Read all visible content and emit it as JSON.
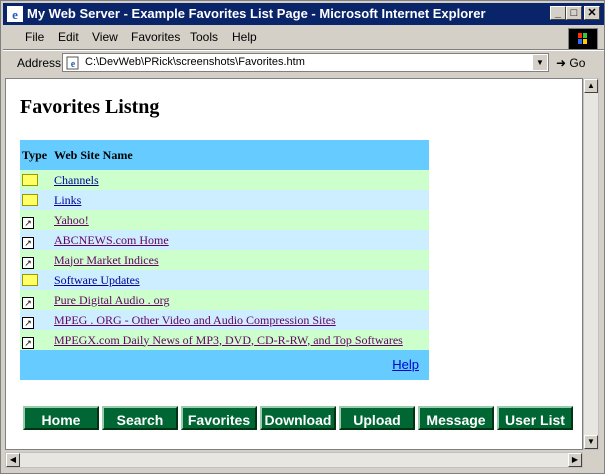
{
  "window": {
    "title": "My Web Server - Example Favorites List Page - Microsoft Internet Explorer"
  },
  "menu": [
    "File",
    "Edit",
    "View",
    "Favorites",
    "Tools",
    "Help"
  ],
  "address": {
    "label": "Address",
    "url": "C:\\DevWeb\\PRick\\screenshots\\Favorites.htm",
    "go_label": "Go"
  },
  "page": {
    "heading": "Favorites Listng",
    "columns": [
      "Type",
      "Web Site Name"
    ],
    "rows": [
      {
        "type": "folder-icon",
        "name": "Channels"
      },
      {
        "type": "folder-icon",
        "name": "Links"
      },
      {
        "type": "shortcut-icon",
        "name": "Yahoo!"
      },
      {
        "type": "shortcut-icon",
        "name": "ABCNEWS.com Home"
      },
      {
        "type": "shortcut-icon",
        "name": "Major Market Indices"
      },
      {
        "type": "folder-icon",
        "name": "Software Updates"
      },
      {
        "type": "shortcut-icon",
        "name": "Pure Digital Audio . org"
      },
      {
        "type": "shortcut-icon",
        "name": "MPEG . ORG - Other Video and Audio Compression Sites"
      },
      {
        "type": "shortcut-icon",
        "name": "MPEGX.com Daily News of MP3, DVD, CD-R-RW, and Top Softwares"
      }
    ],
    "help_link": "Help",
    "nav_buttons": [
      "Home",
      "Search",
      "Favorites",
      "Download",
      "Upload",
      "Message",
      "User List"
    ]
  },
  "colors": {
    "header_row": "#66ccff",
    "green_row": "#ccffcc",
    "blue_row": "#cceeff",
    "nav_button": "#006633",
    "title_bar": "#0a246a"
  }
}
